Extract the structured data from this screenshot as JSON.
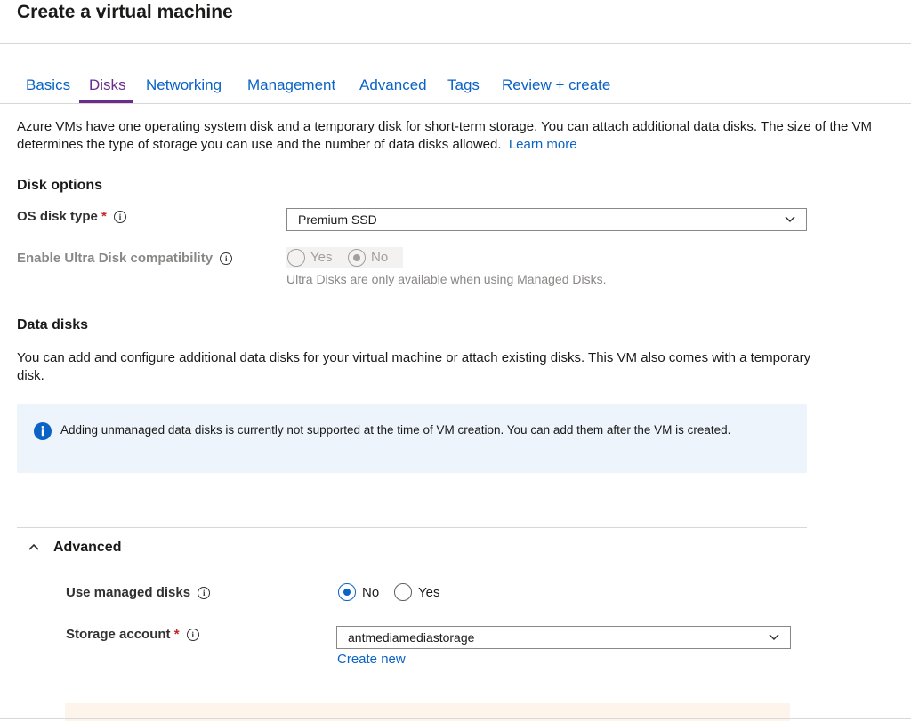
{
  "header": {
    "title": "Create a virtual machine"
  },
  "tabs": [
    {
      "label": "Basics"
    },
    {
      "label": "Disks"
    },
    {
      "label": "Networking"
    },
    {
      "label": "Management"
    },
    {
      "label": "Advanced"
    },
    {
      "label": "Tags"
    },
    {
      "label": "Review + create"
    }
  ],
  "selected_tab": "Disks",
  "intro": {
    "text": "Azure VMs have one operating system disk and a temporary disk for short-term storage. You can attach additional data disks. The size of the VM determines the type of storage you can use and the number of data disks allowed.",
    "learn_more": "Learn more"
  },
  "disk_options": {
    "heading": "Disk options",
    "os_disk_type": {
      "label": "OS disk type",
      "required": "*",
      "value": "Premium SSD"
    },
    "ultra_disk": {
      "label": "Enable Ultra Disk compatibility",
      "yes": "Yes",
      "no": "No",
      "selected": "No",
      "helper": "Ultra Disks are only available when using Managed Disks."
    }
  },
  "data_disks": {
    "heading": "Data disks",
    "description": "You can add and configure additional data disks for your virtual machine or attach existing disks. This VM also comes with a temporary disk.",
    "info_message": "Adding unmanaged data disks is currently not supported at the time of VM creation. You can add them after the VM is created."
  },
  "advanced": {
    "title": "Advanced",
    "expanded": true,
    "use_managed_disks": {
      "label": "Use managed disks",
      "no": "No",
      "yes": "Yes",
      "selected": "No"
    },
    "storage_account": {
      "label": "Storage account",
      "required": "*",
      "value": "antmediamediastorage",
      "create_new": "Create new"
    }
  },
  "colors": {
    "link": "#0a63c5",
    "selected_tab": "#6b2c8e",
    "required": "#c4262e",
    "info_bg": "#eef4fb",
    "info_icon": "#0a63c5"
  },
  "icons": {
    "info": "info-icon",
    "dropdown": "chevron-down-icon",
    "section_toggle": "chevron-up-icon",
    "message": "info-filled-icon"
  }
}
